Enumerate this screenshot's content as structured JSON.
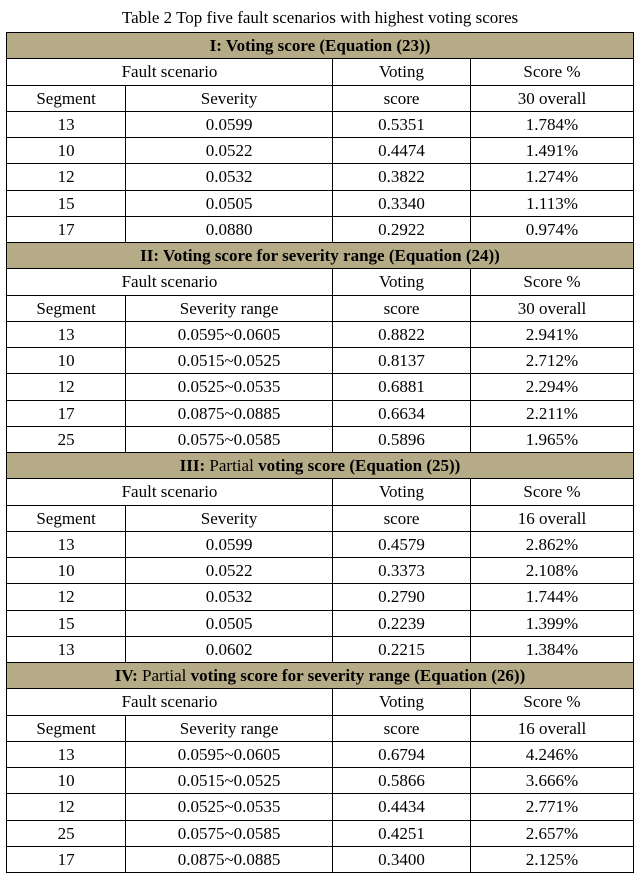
{
  "caption": "Table 2 Top five fault scenarios with highest voting scores",
  "sections": [
    {
      "title_prefix": "I: ",
      "title_main": "Voting score (Equation (23))",
      "title_partial": "",
      "second_col_label": "Severity",
      "overall_label": "30 overall",
      "header_fs": "Fault scenario",
      "header_vs": "Voting score",
      "header_sp": "Score %",
      "rows": [
        {
          "seg": "13",
          "sev": "0.0599",
          "vs": "0.5351",
          "pct": "1.784%"
        },
        {
          "seg": "10",
          "sev": "0.0522",
          "vs": "0.4474",
          "pct": "1.491%"
        },
        {
          "seg": "12",
          "sev": "0.0532",
          "vs": "0.3822",
          "pct": "1.274%"
        },
        {
          "seg": "15",
          "sev": "0.0505",
          "vs": "0.3340",
          "pct": "1.113%"
        },
        {
          "seg": "17",
          "sev": "0.0880",
          "vs": "0.2922",
          "pct": "0.974%"
        }
      ]
    },
    {
      "title_prefix": "II: ",
      "title_main": "Voting score for severity range (Equation (24))",
      "title_partial": "",
      "second_col_label": "Severity range",
      "overall_label": "30 overall",
      "header_fs": "Fault scenario",
      "header_vs": "Voting score",
      "header_sp": "Score %",
      "rows": [
        {
          "seg": "13",
          "sev": "0.0595~0.0605",
          "vs": "0.8822",
          "pct": "2.941%"
        },
        {
          "seg": "10",
          "sev": "0.0515~0.0525",
          "vs": "0.8137",
          "pct": "2.712%"
        },
        {
          "seg": "12",
          "sev": "0.0525~0.0535",
          "vs": "0.6881",
          "pct": "2.294%"
        },
        {
          "seg": "17",
          "sev": "0.0875~0.0885",
          "vs": "0.6634",
          "pct": "2.211%"
        },
        {
          "seg": "25",
          "sev": "0.0575~0.0585",
          "vs": "0.5896",
          "pct": "1.965%"
        }
      ]
    },
    {
      "title_prefix": "III: ",
      "title_partial": "Partial ",
      "title_main": "voting score (Equation (25))",
      "second_col_label": "Severity",
      "overall_label": "16 overall",
      "header_fs": "Fault scenario",
      "header_vs": "Voting score",
      "header_sp": "Score %",
      "rows": [
        {
          "seg": "13",
          "sev": "0.0599",
          "vs": "0.4579",
          "pct": "2.862%"
        },
        {
          "seg": "10",
          "sev": "0.0522",
          "vs": "0.3373",
          "pct": "2.108%"
        },
        {
          "seg": "12",
          "sev": "0.0532",
          "vs": "0.2790",
          "pct": "1.744%"
        },
        {
          "seg": "15",
          "sev": "0.0505",
          "vs": "0.2239",
          "pct": "1.399%"
        },
        {
          "seg": "13",
          "sev": "0.0602",
          "vs": "0.2215",
          "pct": "1.384%"
        }
      ]
    },
    {
      "title_prefix": "IV: ",
      "title_partial": "Partial ",
      "title_main": "voting score for severity range (Equation (26))",
      "second_col_label": "Severity range",
      "overall_label": "16 overall",
      "header_fs": "Fault scenario",
      "header_vs": "Voting score",
      "header_sp": "Score %",
      "rows": [
        {
          "seg": "13",
          "sev": "0.0595~0.0605",
          "vs": "0.6794",
          "pct": "4.246%"
        },
        {
          "seg": "10",
          "sev": "0.0515~0.0525",
          "vs": "0.5866",
          "pct": "3.666%"
        },
        {
          "seg": "12",
          "sev": "0.0525~0.0535",
          "vs": "0.4434",
          "pct": "2.771%"
        },
        {
          "seg": "25",
          "sev": "0.0575~0.0585",
          "vs": "0.4251",
          "pct": "2.657%"
        },
        {
          "seg": "17",
          "sev": "0.0875~0.0885",
          "vs": "0.3400",
          "pct": "2.125%"
        }
      ]
    }
  ],
  "col_segment": "Segment",
  "chart_data": {
    "type": "table",
    "title": "Top five fault scenarios with highest voting scores",
    "groups": [
      {
        "name": "I Voting score (Eq 23)",
        "columns": [
          "Segment",
          "Severity",
          "Voting score",
          "Score % 30 overall"
        ],
        "rows": [
          [
            13,
            0.0599,
            0.5351,
            1.784
          ],
          [
            10,
            0.0522,
            0.4474,
            1.491
          ],
          [
            12,
            0.0532,
            0.3822,
            1.274
          ],
          [
            15,
            0.0505,
            0.334,
            1.113
          ],
          [
            17,
            0.088,
            0.2922,
            0.974
          ]
        ]
      },
      {
        "name": "II Voting score for severity range (Eq 24)",
        "columns": [
          "Segment",
          "Severity range",
          "Voting score",
          "Score % 30 overall"
        ],
        "rows": [
          [
            13,
            "0.0595~0.0605",
            0.8822,
            2.941
          ],
          [
            10,
            "0.0515~0.0525",
            0.8137,
            2.712
          ],
          [
            12,
            "0.0525~0.0535",
            0.6881,
            2.294
          ],
          [
            17,
            "0.0875~0.0885",
            0.6634,
            2.211
          ],
          [
            25,
            "0.0575~0.0585",
            0.5896,
            1.965
          ]
        ]
      },
      {
        "name": "III Partial voting score (Eq 25)",
        "columns": [
          "Segment",
          "Severity",
          "Voting score",
          "Score % 16 overall"
        ],
        "rows": [
          [
            13,
            0.0599,
            0.4579,
            2.862
          ],
          [
            10,
            0.0522,
            0.3373,
            2.108
          ],
          [
            12,
            0.0532,
            0.279,
            1.744
          ],
          [
            15,
            0.0505,
            0.2239,
            1.399
          ],
          [
            13,
            0.0602,
            0.2215,
            1.384
          ]
        ]
      },
      {
        "name": "IV Partial voting score for severity range (Eq 26)",
        "columns": [
          "Segment",
          "Severity range",
          "Voting score",
          "Score % 16 overall"
        ],
        "rows": [
          [
            13,
            "0.0595~0.0605",
            0.6794,
            4.246
          ],
          [
            10,
            "0.0515~0.0525",
            0.5866,
            3.666
          ],
          [
            12,
            "0.0525~0.0535",
            0.4434,
            2.771
          ],
          [
            25,
            "0.0575~0.0585",
            0.4251,
            2.657
          ],
          [
            17,
            "0.0875~0.0885",
            0.34,
            2.125
          ]
        ]
      }
    ]
  }
}
